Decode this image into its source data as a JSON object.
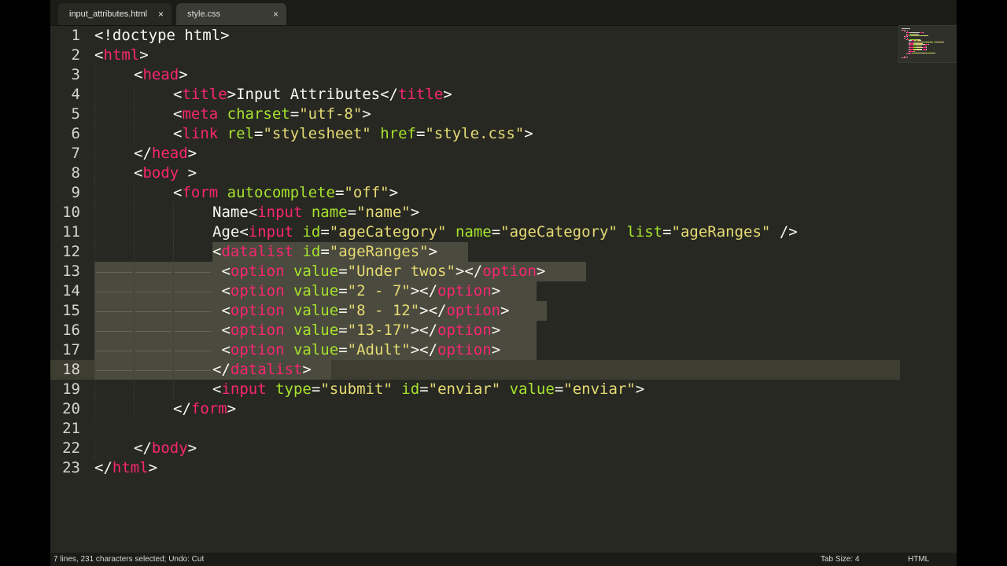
{
  "tabs": [
    {
      "label": "input_attributes.html",
      "close": "×",
      "active": true
    },
    {
      "label": "style.css",
      "close": "×",
      "active": false
    }
  ],
  "line_numbers": [
    "1",
    "2",
    "3",
    "4",
    "5",
    "6",
    "7",
    "8",
    "9",
    "10",
    "11",
    "12",
    "13",
    "14",
    "15",
    "16",
    "17",
    "18",
    "19",
    "20",
    "21",
    "22",
    "23"
  ],
  "status": {
    "left": "7 lines, 231 characters selected; Undo: Cut",
    "tab_size": "Tab Size: 4",
    "syntax": "HTML"
  },
  "theme": {
    "background": "#272822",
    "tag": "#f92672",
    "attribute": "#a6e22e",
    "string": "#e6db74",
    "text": "#f8f8f2"
  },
  "code_lines": [
    {
      "indent": 0,
      "tokens": [
        [
          "p",
          "<!doctype html>"
        ]
      ]
    },
    {
      "indent": 0,
      "tokens": [
        [
          "p",
          "<"
        ],
        [
          "t",
          "html"
        ],
        [
          "p",
          ">"
        ]
      ]
    },
    {
      "indent": 1,
      "tokens": [
        [
          "p",
          "<"
        ],
        [
          "t",
          "head"
        ],
        [
          "p",
          ">"
        ]
      ]
    },
    {
      "indent": 2,
      "tokens": [
        [
          "p",
          "<"
        ],
        [
          "t",
          "title"
        ],
        [
          "p",
          ">Input Attributes</"
        ],
        [
          "t",
          "title"
        ],
        [
          "p",
          ">"
        ]
      ]
    },
    {
      "indent": 2,
      "tokens": [
        [
          "p",
          "<"
        ],
        [
          "t",
          "meta"
        ],
        [
          "p",
          " "
        ],
        [
          "a",
          "charset"
        ],
        [
          "p",
          "="
        ],
        [
          "s",
          "\"utf-8\""
        ],
        [
          "p",
          ">"
        ]
      ]
    },
    {
      "indent": 2,
      "tokens": [
        [
          "p",
          "<"
        ],
        [
          "t",
          "link"
        ],
        [
          "p",
          " "
        ],
        [
          "a",
          "rel"
        ],
        [
          "p",
          "="
        ],
        [
          "s",
          "\"stylesheet\""
        ],
        [
          "p",
          " "
        ],
        [
          "a",
          "href"
        ],
        [
          "p",
          "="
        ],
        [
          "s",
          "\"style.css\""
        ],
        [
          "p",
          ">"
        ]
      ]
    },
    {
      "indent": 1,
      "tokens": [
        [
          "p",
          "</"
        ],
        [
          "t",
          "head"
        ],
        [
          "p",
          ">"
        ]
      ]
    },
    {
      "indent": 1,
      "tokens": [
        [
          "p",
          "<"
        ],
        [
          "t",
          "body"
        ],
        [
          "p",
          " >"
        ]
      ]
    },
    {
      "indent": 2,
      "tokens": [
        [
          "p",
          "<"
        ],
        [
          "t",
          "form"
        ],
        [
          "p",
          " "
        ],
        [
          "a",
          "autocomplete"
        ],
        [
          "p",
          "="
        ],
        [
          "s",
          "\"off\""
        ],
        [
          "p",
          ">"
        ]
      ]
    },
    {
      "indent": 3,
      "tokens": [
        [
          "p",
          "Name<"
        ],
        [
          "t",
          "input"
        ],
        [
          "p",
          " "
        ],
        [
          "a",
          "name"
        ],
        [
          "p",
          "="
        ],
        [
          "s",
          "\"name\""
        ],
        [
          "p",
          ">"
        ]
      ]
    },
    {
      "indent": 3,
      "tokens": [
        [
          "p",
          "Age<"
        ],
        [
          "t",
          "input"
        ],
        [
          "p",
          " "
        ],
        [
          "a",
          "id"
        ],
        [
          "p",
          "="
        ],
        [
          "s",
          "\"ageCategory\""
        ],
        [
          "p",
          " "
        ],
        [
          "a",
          "name"
        ],
        [
          "p",
          "="
        ],
        [
          "s",
          "\"ageCategory\""
        ],
        [
          "p",
          " "
        ],
        [
          "a",
          "list"
        ],
        [
          "p",
          "="
        ],
        [
          "s",
          "\"ageRanges\""
        ],
        [
          "p",
          " />"
        ]
      ]
    },
    {
      "indent": 3,
      "tokens": [
        [
          "p",
          "<"
        ],
        [
          "t",
          "datalist"
        ],
        [
          "p",
          " "
        ],
        [
          "a",
          "id"
        ],
        [
          "p",
          "="
        ],
        [
          "s",
          "\"ageRanges\""
        ],
        [
          "p",
          ">"
        ]
      ]
    },
    {
      "indent": 3,
      "ws": true,
      "tokens": [
        [
          "p",
          " <"
        ],
        [
          "t",
          "option"
        ],
        [
          "p",
          " "
        ],
        [
          "a",
          "value"
        ],
        [
          "p",
          "="
        ],
        [
          "s",
          "\"Under twos\""
        ],
        [
          "p",
          "></"
        ],
        [
          "t",
          "option"
        ],
        [
          "p",
          ">"
        ]
      ]
    },
    {
      "indent": 3,
      "ws": true,
      "tokens": [
        [
          "p",
          " <"
        ],
        [
          "t",
          "option"
        ],
        [
          "p",
          " "
        ],
        [
          "a",
          "value"
        ],
        [
          "p",
          "="
        ],
        [
          "s",
          "\"2 - 7\""
        ],
        [
          "p",
          "></"
        ],
        [
          "t",
          "option"
        ],
        [
          "p",
          ">"
        ]
      ]
    },
    {
      "indent": 3,
      "ws": true,
      "tokens": [
        [
          "p",
          " <"
        ],
        [
          "t",
          "option"
        ],
        [
          "p",
          " "
        ],
        [
          "a",
          "value"
        ],
        [
          "p",
          "="
        ],
        [
          "s",
          "\"8 - 12\""
        ],
        [
          "p",
          "></"
        ],
        [
          "t",
          "option"
        ],
        [
          "p",
          ">"
        ]
      ]
    },
    {
      "indent": 3,
      "ws": true,
      "tokens": [
        [
          "p",
          " <"
        ],
        [
          "t",
          "option"
        ],
        [
          "p",
          " "
        ],
        [
          "a",
          "value"
        ],
        [
          "p",
          "="
        ],
        [
          "s",
          "\"13-17\""
        ],
        [
          "p",
          "></"
        ],
        [
          "t",
          "option"
        ],
        [
          "p",
          ">"
        ]
      ]
    },
    {
      "indent": 3,
      "ws": true,
      "tokens": [
        [
          "p",
          " <"
        ],
        [
          "t",
          "option"
        ],
        [
          "p",
          " "
        ],
        [
          "a",
          "value"
        ],
        [
          "p",
          "="
        ],
        [
          "s",
          "\"Adult\""
        ],
        [
          "p",
          "></"
        ],
        [
          "t",
          "option"
        ],
        [
          "p",
          ">"
        ]
      ]
    },
    {
      "indent": 3,
      "ws": true,
      "tokens": [
        [
          "p",
          "</"
        ],
        [
          "t",
          "datalist"
        ],
        [
          "p",
          ">"
        ]
      ]
    },
    {
      "indent": 3,
      "tokens": [
        [
          "p",
          "<"
        ],
        [
          "t",
          "input"
        ],
        [
          "p",
          " "
        ],
        [
          "a",
          "type"
        ],
        [
          "p",
          "="
        ],
        [
          "s",
          "\"submit\""
        ],
        [
          "p",
          " "
        ],
        [
          "a",
          "id"
        ],
        [
          "p",
          "="
        ],
        [
          "s",
          "\"enviar\""
        ],
        [
          "p",
          " "
        ],
        [
          "a",
          "value"
        ],
        [
          "p",
          "="
        ],
        [
          "s",
          "\"enviar\""
        ],
        [
          "p",
          ">"
        ]
      ]
    },
    {
      "indent": 2,
      "tokens": [
        [
          "p",
          "</"
        ],
        [
          "t",
          "form"
        ],
        [
          "p",
          ">"
        ]
      ]
    },
    {
      "indent": 0,
      "tokens": []
    },
    {
      "indent": 1,
      "tokens": [
        [
          "p",
          "</"
        ],
        [
          "t",
          "body"
        ],
        [
          "p",
          ">"
        ]
      ]
    },
    {
      "indent": 0,
      "tokens": [
        [
          "p",
          "</"
        ],
        [
          "t",
          "html"
        ],
        [
          "p",
          ">"
        ]
      ]
    }
  ],
  "selection_lines": [
    12,
    13,
    14,
    15,
    16,
    17,
    18
  ],
  "current_line": 18
}
